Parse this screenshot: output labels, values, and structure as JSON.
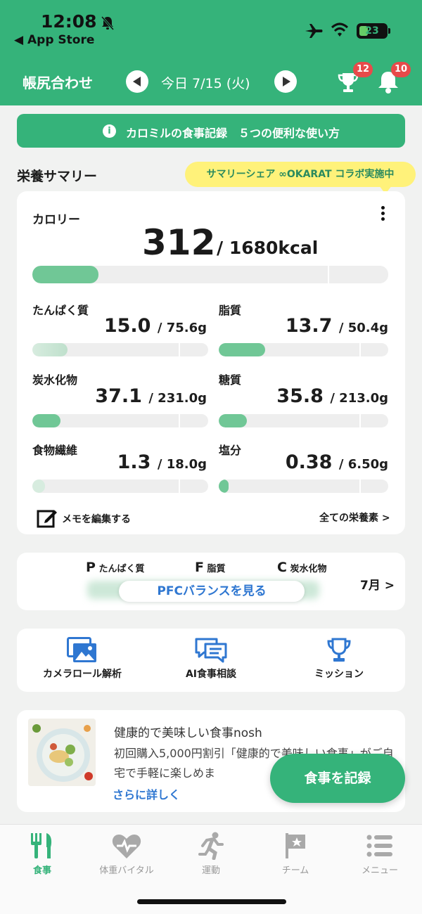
{
  "status": {
    "time": "12:08",
    "back_label": "◀ App Store",
    "battery": "23"
  },
  "header": {
    "title": "帳尻合わせ",
    "date": "今日 7/15 (火)",
    "trophy_count": "12",
    "notification_count": "10"
  },
  "guide_banner": {
    "icon": "i",
    "text": "カロミルの食事記録　５つの便利な使い方"
  },
  "summary": {
    "section_title": "栄養サマリー",
    "tooltip": "サマリーシェア ∞OKARAT コラボ実施中",
    "calorie": {
      "label": "カロリー",
      "value": "312",
      "target": "/ 1680kcal",
      "progress": 0.186
    },
    "nutrients": [
      {
        "label": "たんぱく質",
        "value": "15.0",
        "target": "/ 75.6g",
        "progress": 0.198
      },
      {
        "label": "脂質",
        "value": "13.7",
        "target": "/ 50.4g",
        "progress": 0.272
      },
      {
        "label": "炭水化物",
        "value": "37.1",
        "target": "/ 231.0g",
        "progress": 0.161
      },
      {
        "label": "糖質",
        "value": "35.8",
        "target": "/ 213.0g",
        "progress": 0.168
      },
      {
        "label": "食物繊維",
        "value": "1.3",
        "target": "/ 18.0g",
        "progress": 0.072
      },
      {
        "label": "塩分",
        "value": "0.38",
        "target": "/ 6.50g",
        "progress": 0.058
      }
    ],
    "memo_label": "メモを編集する",
    "all_nutrients_label": "全ての栄養素 >"
  },
  "pfc": {
    "p_letter": "P",
    "p_label": "たんぱく質",
    "f_letter": "F",
    "f_label": "脂質",
    "c_letter": "C",
    "c_label": "炭水化物",
    "button": "PFCバランスを見る",
    "month": "7月 >"
  },
  "tools": [
    {
      "label": "カメラロール解析",
      "icon": "photos-icon"
    },
    {
      "label": "AI食事相談",
      "icon": "chat-icon"
    },
    {
      "label": "ミッション",
      "icon": "trophy-icon"
    }
  ],
  "ad": {
    "title": "健康的で美味しい食事nosh",
    "description": "初回購入5,000円割引「健康的で美味しい食事」がご自宅で手軽に楽しめま",
    "link": "さらに詳しく"
  },
  "fab_label": "食事を記録",
  "bottom_nav": [
    {
      "label": "食事",
      "icon": "fork-knife-icon",
      "active": true
    },
    {
      "label": "体重バイタル",
      "icon": "heart-icon",
      "active": false
    },
    {
      "label": "運動",
      "icon": "runner-icon",
      "active": false
    },
    {
      "label": "チーム",
      "icon": "flag-icon",
      "active": false
    },
    {
      "label": "メニュー",
      "icon": "menu-icon",
      "active": false
    }
  ],
  "colors": {
    "brand": "#35b37a",
    "bar_fill": "#70c796",
    "link": "#2f77d1",
    "badge": "#e84a4a",
    "tooltip": "#fff27a"
  }
}
